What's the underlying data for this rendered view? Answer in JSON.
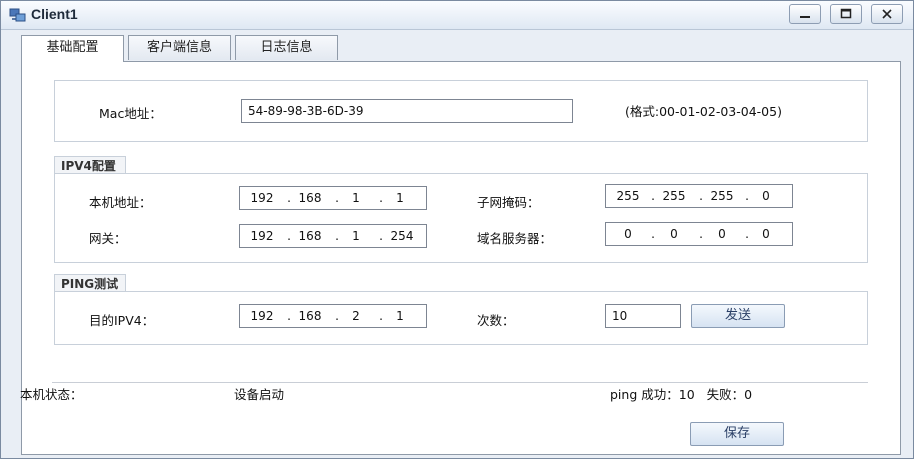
{
  "window": {
    "title": "Client1"
  },
  "tabs": [
    {
      "label": "基础配置",
      "active": true
    },
    {
      "label": "客户端信息",
      "active": false
    },
    {
      "label": "日志信息",
      "active": false
    }
  ],
  "mac": {
    "label": "Mac地址：",
    "value": "54-89-98-3B-6D-39",
    "hint": "(格式:00-01-02-03-04-05)"
  },
  "ipv4": {
    "title": "IPV4配置",
    "local_label": "本机地址：",
    "local": [
      "192",
      "168",
      "1",
      "1"
    ],
    "mask_label": "子网掩码：",
    "mask": [
      "255",
      "255",
      "255",
      "0"
    ],
    "gateway_label": "网关：",
    "gateway": [
      "192",
      "168",
      "1",
      "254"
    ],
    "dns_label": "域名服务器：",
    "dns": [
      "0",
      "0",
      "0",
      "0"
    ]
  },
  "ping": {
    "title": "PING测试",
    "dest_label": "目的IPV4：",
    "dest": [
      "192",
      "168",
      "2",
      "1"
    ],
    "count_label": "次数：",
    "count": "10",
    "send_label": "发送"
  },
  "status": {
    "label": "本机状态：",
    "value": "设备启动",
    "ping_result": "ping 成功：10   失败：0"
  },
  "save_label": "保存"
}
